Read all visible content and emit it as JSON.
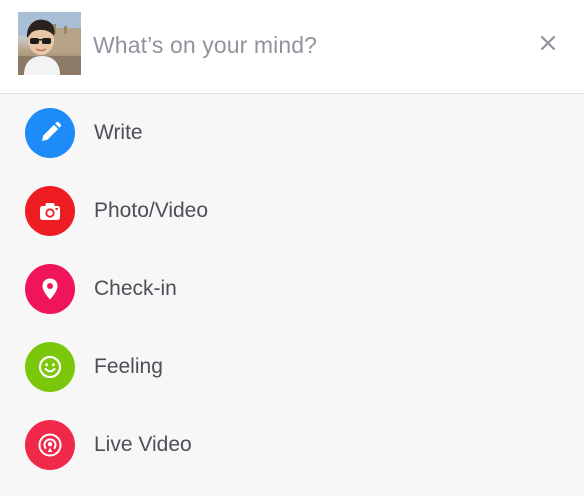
{
  "composer": {
    "prompt": "What’s on your mind?",
    "close_glyph": "×",
    "close_icon": "close-icon",
    "avatar": "avatar-photo"
  },
  "options": [
    {
      "id": "write",
      "label": "Write",
      "icon": "pencil-icon",
      "color": "#1d8cf8"
    },
    {
      "id": "photo-video",
      "label": "Photo/Video",
      "icon": "camera-icon",
      "color": "#ee1d24"
    },
    {
      "id": "check-in",
      "label": "Check-in",
      "icon": "location-pin-icon",
      "color": "#f0155b"
    },
    {
      "id": "feeling",
      "label": "Feeling",
      "icon": "smiley-icon",
      "color": "#7ac70c"
    },
    {
      "id": "live-video",
      "label": "Live Video",
      "icon": "live-broadcast-icon",
      "color": "#f02849"
    }
  ],
  "colors": {
    "header_bg": "#ffffff",
    "list_bg": "#f7f7f7",
    "placeholder": "#90949c",
    "label": "#4b4f56",
    "divider": "#dddfe2"
  }
}
